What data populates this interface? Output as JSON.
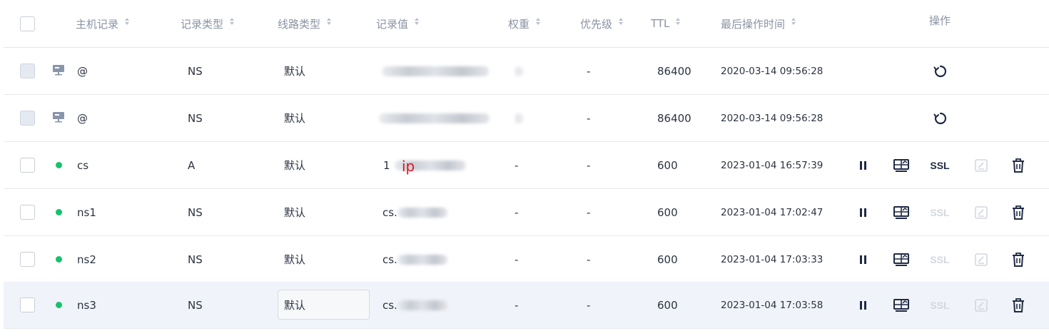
{
  "header": {
    "columns": {
      "host": "主机记录",
      "type": "记录类型",
      "line": "线路类型",
      "value": "记录值",
      "weight": "权重",
      "priority": "优先级",
      "ttl": "TTL",
      "time": "最后操作时间",
      "ops": "操作"
    }
  },
  "rows": [
    {
      "status": "system",
      "host": "@",
      "type": "NS",
      "line": "默认",
      "value": "",
      "weight": "",
      "priority": "-",
      "ttl": "86400",
      "time": "2020-03-14 09:56:28",
      "ops": "reset-only"
    },
    {
      "status": "system",
      "host": "@",
      "type": "NS",
      "line": "默认",
      "value": "",
      "weight": "",
      "priority": "-",
      "ttl": "86400",
      "time": "2020-03-14 09:56:28",
      "ops": "reset-only"
    },
    {
      "status": "enabled",
      "host": "cs",
      "type": "A",
      "line": "默认",
      "value": "1",
      "value_annotation": "ip",
      "weight": "-",
      "priority": "-",
      "ttl": "600",
      "time": "2023-01-04 16:57:39",
      "ops": "full",
      "ssl_enabled": true
    },
    {
      "status": "enabled",
      "host": "ns1",
      "type": "NS",
      "line": "默认",
      "value": "cs.",
      "weight": "-",
      "priority": "-",
      "ttl": "600",
      "time": "2023-01-04 17:02:47",
      "ops": "full",
      "ssl_enabled": false
    },
    {
      "status": "enabled",
      "host": "ns2",
      "type": "NS",
      "line": "默认",
      "value": "cs.",
      "weight": "-",
      "priority": "-",
      "ttl": "600",
      "time": "2023-01-04 17:03:33",
      "ops": "full",
      "ssl_enabled": false
    },
    {
      "status": "enabled",
      "host": "ns3",
      "type": "NS",
      "line": "默认",
      "value": "cs.",
      "weight": "-",
      "priority": "-",
      "ttl": "600",
      "time": "2023-01-04 17:03:58",
      "ops": "full",
      "ssl_enabled": false,
      "highlighted": true
    }
  ],
  "ops_labels": {
    "ssl": "SSL"
  },
  "icons": {
    "system": "monitor-icon",
    "enabled": "status-dot-icon",
    "reset": "refresh-icon",
    "pause": "pause-icon",
    "monitor": "monitor-chart-icon",
    "edit": "edit-icon",
    "delete": "trash-icon"
  },
  "colors": {
    "enabled_dot": "#16c26b",
    "icon_dark": "#1f2a44",
    "icon_disabled": "#d3d7df",
    "hover_row": "#f0f3f9",
    "annotation": "#e0141e"
  }
}
